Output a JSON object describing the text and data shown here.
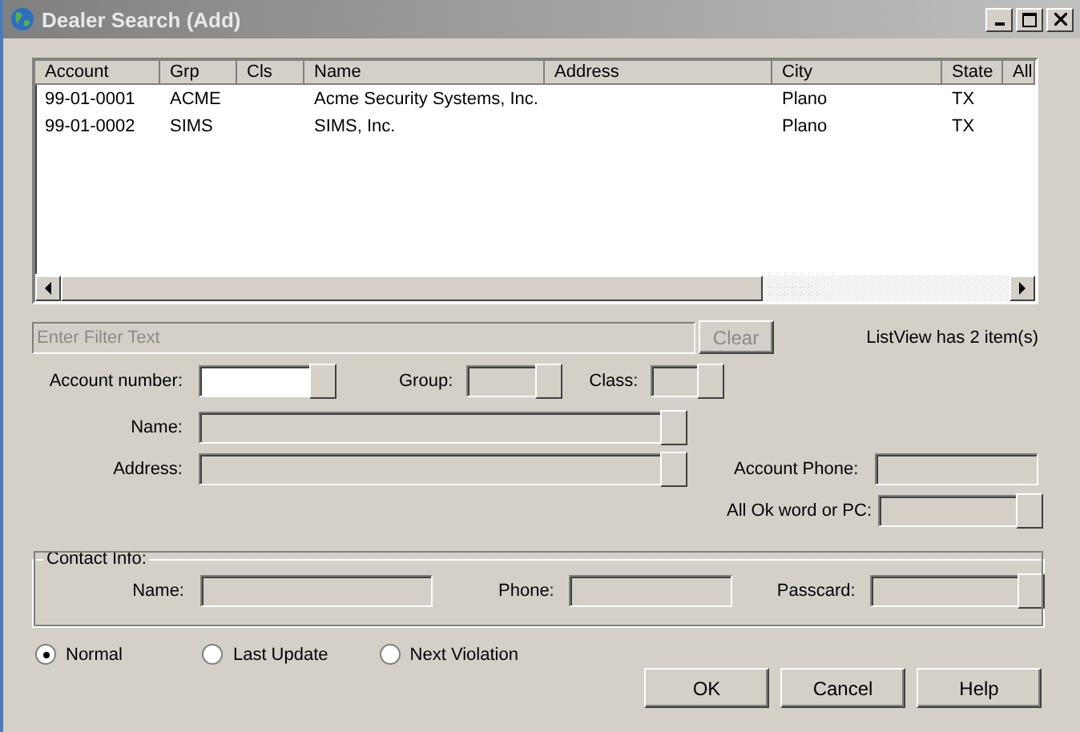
{
  "window": {
    "title": "Dealer Search (Add)"
  },
  "list": {
    "columns": [
      "Account",
      "Grp",
      "Cls",
      "Name",
      "Address",
      "City",
      "State",
      "All"
    ],
    "rows": [
      [
        "99-01-0001",
        "ACME",
        "",
        "Acme Security Systems, Inc.",
        "",
        "Plano",
        "TX",
        ""
      ],
      [
        "99-01-0002",
        "SIMS",
        "",
        "SIMS, Inc.",
        "",
        "Plano",
        "TX",
        ""
      ]
    ]
  },
  "filter": {
    "placeholder": "Enter Filter Text",
    "clear_button": {
      "label": "Clear",
      "disabled": true
    },
    "status": "ListView has 2 item(s)"
  },
  "fields": [
    {
      "label": "Account number:",
      "kind": "combo",
      "disabled": false
    },
    {
      "label": "Group:",
      "kind": "combo",
      "disabled": true
    },
    {
      "label": "Class:",
      "kind": "combo",
      "disabled": true
    },
    {
      "label": "Name:",
      "kind": "combo",
      "disabled": true
    },
    {
      "label": "Address:",
      "kind": "combo",
      "disabled": true
    },
    {
      "label": "Account Phone:",
      "kind": "text",
      "disabled": true
    },
    {
      "label": "All Ok word or PC:",
      "kind": "combo",
      "disabled": true
    }
  ],
  "contact": {
    "title": "Contact Info:",
    "fields": [
      {
        "label": "Name:",
        "kind": "text",
        "disabled": true
      },
      {
        "label": "Phone:",
        "kind": "text",
        "disabled": true
      },
      {
        "label": "Passcard:",
        "kind": "combo",
        "disabled": true
      }
    ]
  },
  "radios": [
    {
      "label": "Normal",
      "selected": true
    },
    {
      "label": "Last Update",
      "selected": false
    },
    {
      "label": "Next Violation",
      "selected": false
    }
  ],
  "buttons": [
    "OK",
    "Cancel",
    "Help"
  ]
}
